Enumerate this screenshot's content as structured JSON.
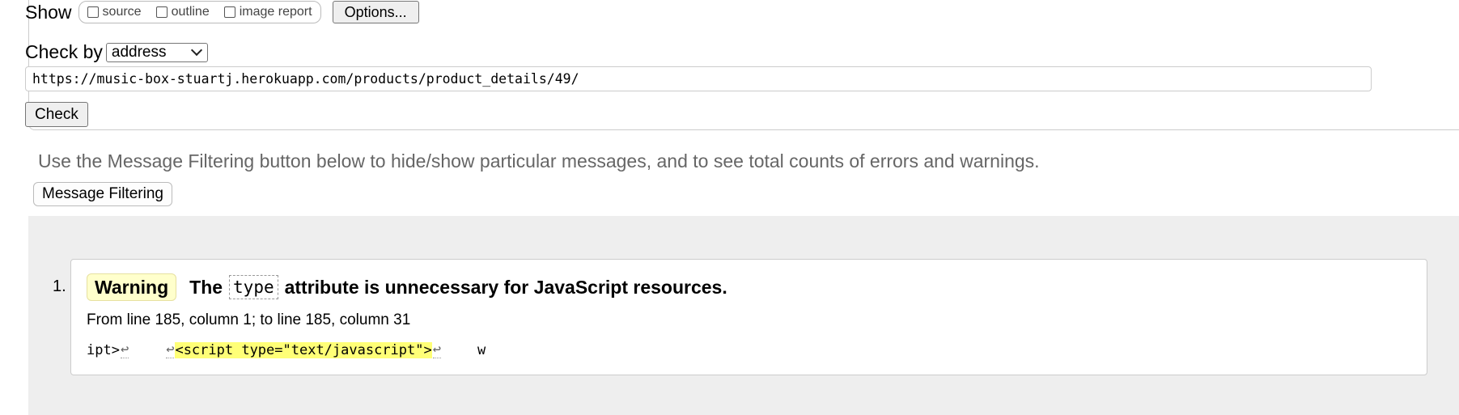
{
  "form": {
    "show_label": "Show",
    "show_options": [
      "source",
      "outline",
      "image report"
    ],
    "options_button": "Options...",
    "check_by_label": "Check by",
    "check_by_value": "address",
    "url_value": "https://music-box-stuartj.herokuapp.com/products/product_details/49/",
    "check_button": "Check"
  },
  "filter": {
    "note": "Use the Message Filtering button below to hide/show particular messages, and to see total counts of errors and warnings.",
    "button": "Message Filtering"
  },
  "messages": [
    {
      "number": "1.",
      "type": "Warning",
      "text_before": "The",
      "code": "type",
      "text_after": "attribute is unnecessary for JavaScript resources.",
      "location": "From line 185, column 1; to line 185, column 31",
      "extract_pre": "ipt>",
      "extract_return": "↩",
      "extract_highlight": "<script type=\"text/javascript\">",
      "extract_post": "w"
    }
  ],
  "colors": {
    "warning_badge_bg": "#ffffcc",
    "highlight": "#ffff77",
    "results_bg": "#eeeeee",
    "note_text": "#666666"
  }
}
